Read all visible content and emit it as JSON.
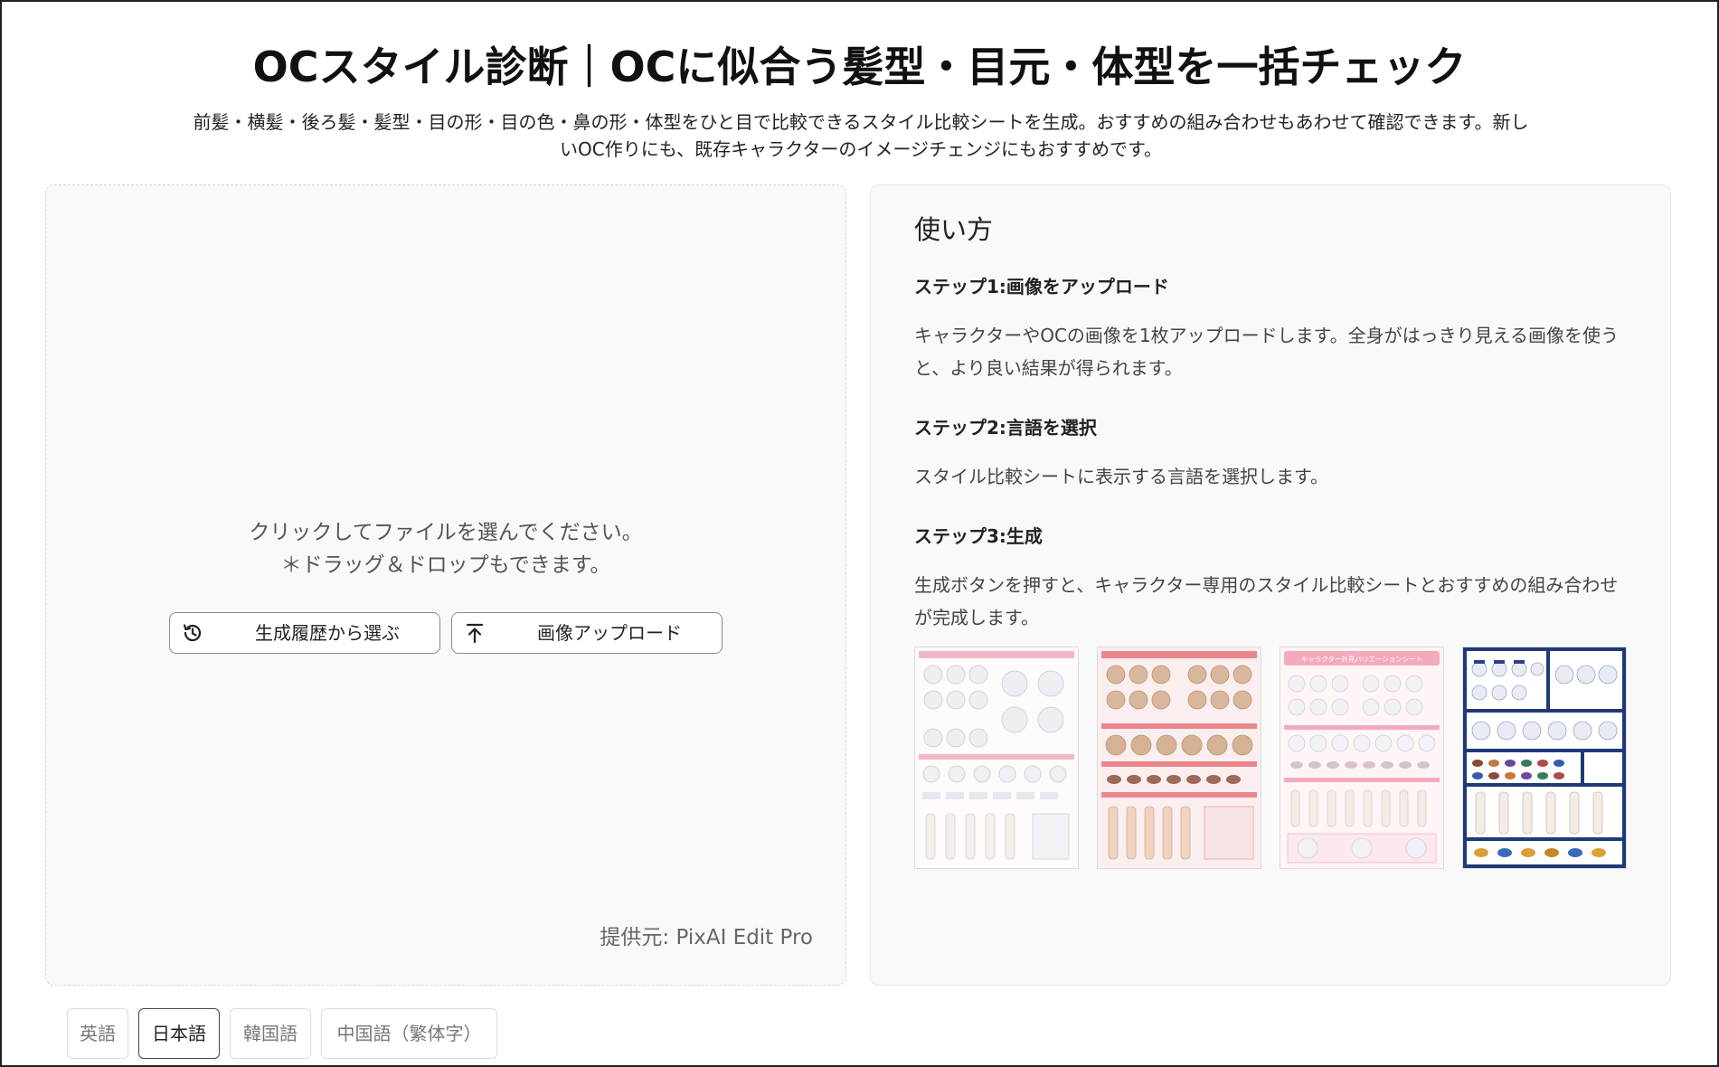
{
  "header": {
    "title": "OCスタイル診断｜OCに似合う髪型・目元・体型を一括チェック",
    "subtitle": "前髪・横髪・後ろ髪・髪型・目の形・目の色・鼻の形・体型をひと目で比較できるスタイル比較シートを生成。おすすめの組み合わせもあわせて確認できます。新しいOC作りにも、既存キャラクターのイメージチェンジにもおすすめです。"
  },
  "upload": {
    "hint_line1": "クリックしてファイルを選んでください。",
    "hint_line2": "＊ドラッグ＆ドロップもできます。",
    "history_button": "生成履歴から選ぶ",
    "upload_button": "画像アップロード",
    "provider": "提供元: PixAI Edit Pro"
  },
  "howto": {
    "title": "使い方",
    "steps": [
      {
        "title": "ステップ1:画像をアップロード",
        "desc": "キャラクターやOCの画像を1枚アップロードします。全身がはっきり見える画像を使うと、より良い結果が得られます。"
      },
      {
        "title": "ステップ2:言語を選択",
        "desc": "スタイル比較シートに表示する言語を選択します。"
      },
      {
        "title": "ステップ3:生成",
        "desc": "生成ボタンを押すと、キャラクター専用のスタイル比較シートとおすすめの組み合わせが完成します。"
      }
    ],
    "thumbnails": [
      {
        "icon": "sample-sheet-white-icon",
        "accent": "#f2b8c6"
      },
      {
        "icon": "sample-sheet-pink-icon",
        "accent": "#e9868f"
      },
      {
        "icon": "sample-sheet-variation-icon",
        "accent": "#f4a9bd",
        "heading": "キャラクター外見バリエーションシート"
      },
      {
        "icon": "sample-sheet-navy-icon",
        "accent": "#1f3a7a"
      }
    ]
  },
  "languages": {
    "items": [
      "英語",
      "日本語",
      "韓国語",
      "中国語（繁体字）"
    ],
    "selected": "日本語"
  }
}
